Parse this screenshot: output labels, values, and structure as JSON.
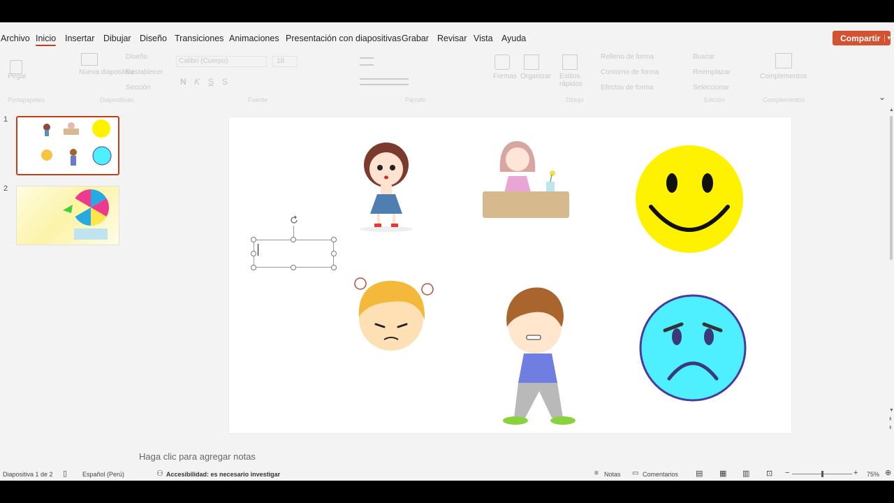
{
  "menu": {
    "tabs": [
      "Archivo",
      "Inicio",
      "Insertar",
      "Dibujar",
      "Diseño",
      "Transiciones",
      "Animaciones",
      "Presentación con diapositivas",
      "Grabar",
      "Revisar",
      "Vista",
      "Ayuda"
    ],
    "active_tab": "Inicio",
    "share_label": "Compartir"
  },
  "ribbon": {
    "paste": "Pegar",
    "new_slide": "Nueva diapositiva",
    "layout": "Diseño",
    "reset": "Restablecer",
    "section": "Sección",
    "font_name": "Calibri (Cuerpo)",
    "font_size": "18",
    "shapes": "Formas",
    "arrange": "Organizar",
    "quick_styles": "Estilos rápidos",
    "fill": "Relleno de forma",
    "outline": "Contorno de forma",
    "effects": "Efectos de forma",
    "find": "Buscar",
    "replace": "Reemplazar",
    "select": "Seleccionar",
    "addins": "Complementos",
    "groups": [
      "Portapapeles",
      "Diapositivas",
      "Fuente",
      "Párrafo",
      "Dibujo",
      "Edición",
      "Complementos"
    ]
  },
  "thumbnails": [
    {
      "number": "1",
      "selected": true
    },
    {
      "number": "2",
      "selected": false
    }
  ],
  "notes": {
    "placeholder": "Haga clic para agregar notas"
  },
  "status": {
    "slide_info": "Diapositiva 1 de 2",
    "language": "Español (Perú)",
    "accessibility_label": "Accesibilidad:",
    "accessibility_value": "es necesario investigar",
    "notes_button": "Notas",
    "comments_button": "Comentarios",
    "zoom_minus": "−",
    "zoom_plus": "+",
    "zoom": "75%",
    "zoom_fraction": 0.5
  },
  "colors": {
    "accent": "#c43e1c",
    "share": "#d35230",
    "happy_face": "#fff200",
    "sad_face": "#4ef0ff",
    "sad_face_border": "#4a3aa0"
  }
}
